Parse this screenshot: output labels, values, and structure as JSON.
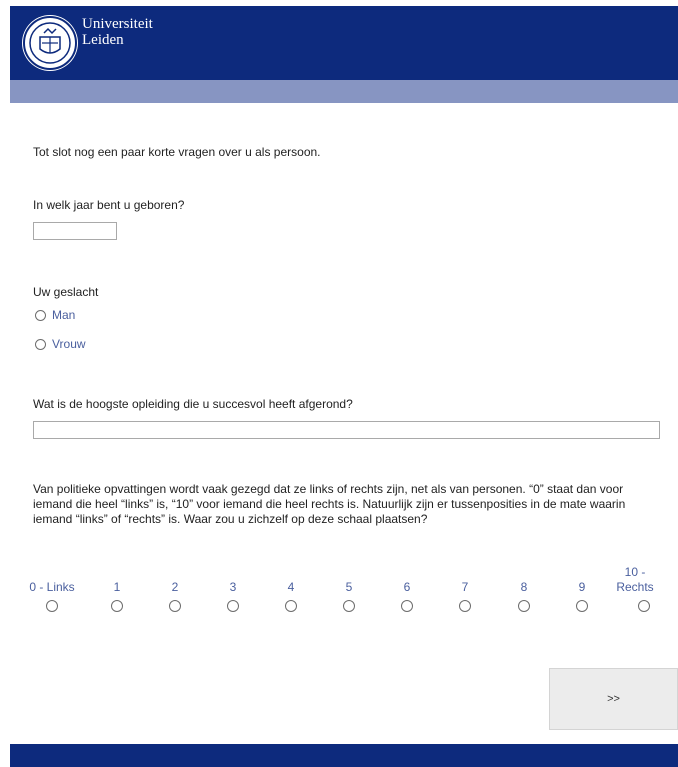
{
  "header": {
    "logo_line1": "Universiteit",
    "logo_line2": "Leiden",
    "seal_icon": "leiden-university-seal-icon",
    "color": "#0d2a7d",
    "band_color": "#8795c2"
  },
  "intro": "Tot slot nog een paar korte vragen over u als persoon.",
  "q_birthyear": {
    "label": "In welk jaar bent u geboren?",
    "value": ""
  },
  "q_gender": {
    "label": "Uw geslacht",
    "options": [
      "Man",
      "Vrouw"
    ]
  },
  "q_education": {
    "label": "Wat is de hoogste opleiding die u succesvol heeft afgerond?",
    "value": ""
  },
  "q_scale": {
    "label": "Van politieke opvattingen wordt vaak gezegd dat ze links of rechts zijn, net als van personen. “0” staat dan voor iemand die heel “links” is, “10” voor iemand die heel rechts is. Natuurlijk zijn er tussenposities in de mate waarin iemand “links” of “rechts” is. Waar zou u zichzelf op deze schaal plaatsen?",
    "options": [
      "0 - Links",
      "1",
      "2",
      "3",
      "4",
      "5",
      "6",
      "7",
      "8",
      "9",
      "10 - Rechts"
    ]
  },
  "nav": {
    "next_label": ">>"
  },
  "colors": {
    "option_text": "#4a5f9e"
  }
}
